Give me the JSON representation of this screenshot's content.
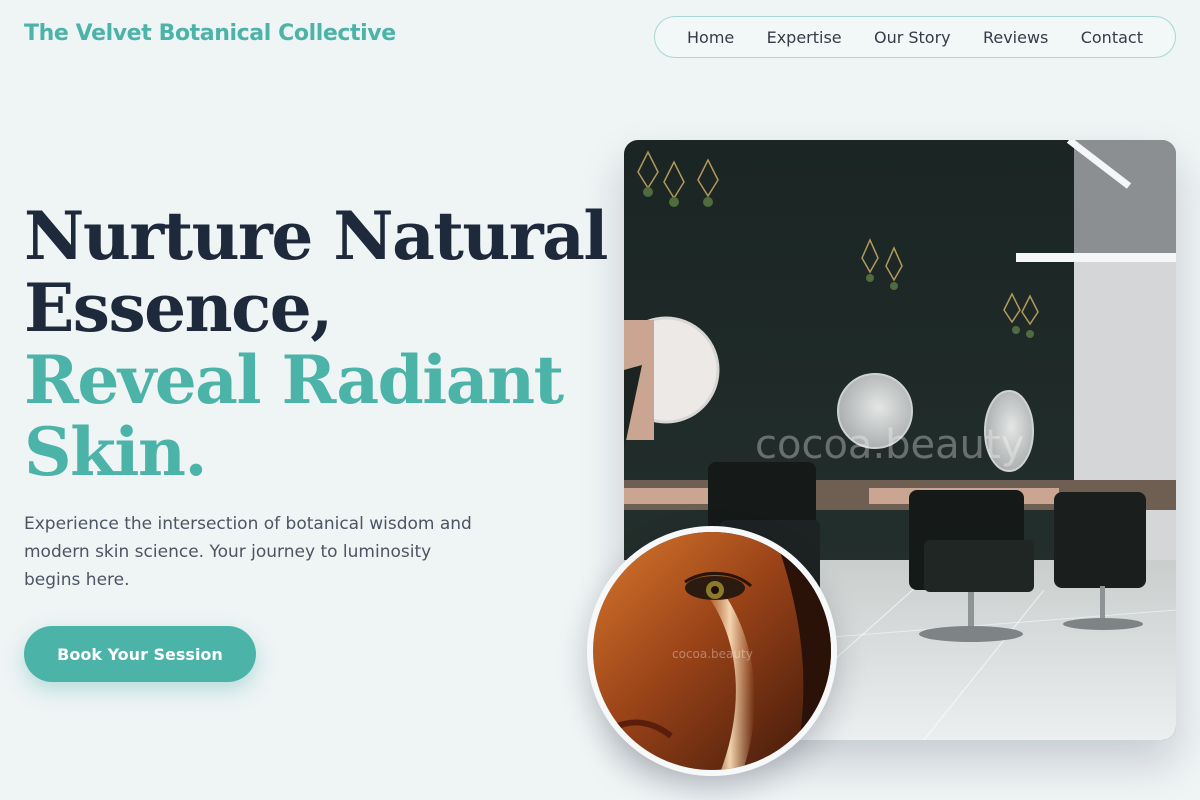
{
  "brand": {
    "name": "The Velvet Botanical Collective"
  },
  "nav": {
    "items": [
      "Home",
      "Expertise",
      "Our Story",
      "Reviews",
      "Contact"
    ]
  },
  "hero": {
    "headline_line1": "Nurture Natural",
    "headline_line2": "Essence,",
    "headline_accent_line1": "Reveal Radiant",
    "headline_accent_line2": "Skin.",
    "subtext": "Experience the intersection of botanical wisdom and modern skin science. Your journey to luminosity begins here.",
    "cta_label": "Book Your Session"
  },
  "images": {
    "main_watermark": "cocoa.beauty",
    "portrait_watermark": "cocoa.beauty"
  },
  "colors": {
    "accent": "#4cb3a9",
    "heading": "#1e293b",
    "body_text": "#4b5563",
    "background": "#eff4f5"
  }
}
